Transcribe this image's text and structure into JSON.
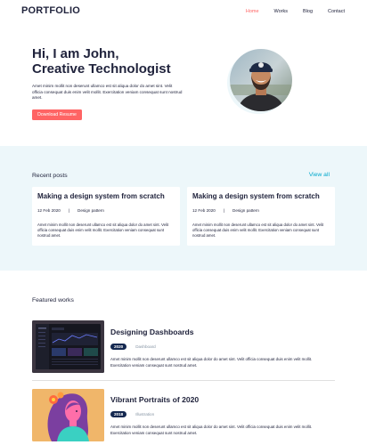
{
  "header": {
    "logo": "PORTFOLIO",
    "nav": [
      "Home",
      "Works",
      "Blog",
      "Contact"
    ],
    "active_nav": "Home"
  },
  "hero": {
    "title_line1": "Hi, I am John,",
    "title_line2": "Creative Technologist",
    "text": "Amet minim mollit non deserunt ullamco est sit aliqua dolor do amet sint. Velit officia consequat duis enim velit mollit. Exercitation veniam consequat sunt nostrud amet.",
    "button": "Download Resume"
  },
  "recent_posts": {
    "heading": "Recent posts",
    "view_all": "View all",
    "posts": [
      {
        "title": "Making a design system from scratch",
        "date": "12 Feb 2020",
        "separator": "|",
        "category": "Design pattern",
        "body": "Amet minim mollit non deserunt ullamco est sit aliqua dolor do amet sint. Velit officia consequat duis enim velit mollit. Exercitation veniam consequat sunt nostrud amet."
      },
      {
        "title": "Making a design system from scratch",
        "date": "12 Feb 2020",
        "separator": "|",
        "category": "Design pattern",
        "body": "Amet minim mollit non deserunt ullamco est sit aliqua dolor do amet sint. Velit officia consequat duis enim velit mollit. Exercitation veniam consequat sunt nostrud amet."
      }
    ]
  },
  "featured_works": {
    "heading": "Featured works",
    "items": [
      {
        "title": "Designing Dashboards",
        "year": "2020",
        "category": "Dashboard",
        "desc": "Amet minim mollit non deserunt ullamco est sit aliqua dolor do amet sint. Velit officia consequat duis enim velit mollit. Exercitation veniam consequat sunt nostrud amet."
      },
      {
        "title": "Vibrant Portraits of 2020",
        "year": "2018",
        "category": "Illustration",
        "desc": "Amet minim mollit non deserunt ullamco est sit aliqua dolor do amet sint. Velit officia consequat duis enim velit mollit. Exercitation veniam consequat sunt nostrud amet."
      }
    ]
  },
  "colors": {
    "accent": "#ff6464",
    "link": "#00a8cc",
    "section_bg": "#edf7fa",
    "text": "#21243d",
    "badge": "#142850"
  }
}
